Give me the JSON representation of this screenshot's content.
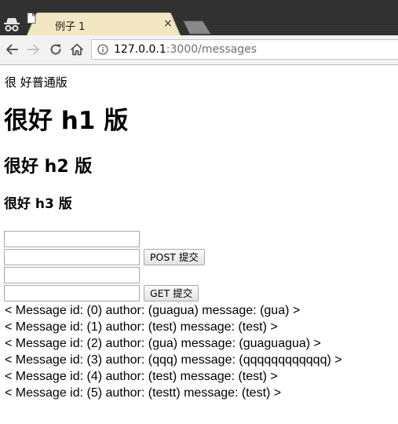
{
  "browser": {
    "tab_title": "例子 1",
    "tab_close": "×",
    "url_host": "127.0.0.1",
    "url_rest": ":3000/messages"
  },
  "page": {
    "plain_text": "很 好普通版",
    "h1": "很好 h1 版",
    "h2": "很好 h2 版",
    "h3": "很好 h3 版",
    "form": {
      "post_field_1_value": "",
      "post_field_2_value": "",
      "post_button_label": "POST 提交",
      "get_field_1_value": "",
      "get_field_2_value": "",
      "get_button_label": "GET 提交"
    },
    "messages": [
      "< Message id: (0) author: (guagua) message: (gua) >",
      "< Message id: (1) author: (test) message: (test) >",
      "< Message id: (2) author: (gua) message: (guaguagua) >",
      "< Message id: (3) author: (qqq) message: (qqqqqqqqqqqq) >",
      "< Message id: (4) author: (test) message: (test) >",
      "< Message id: (5) author: (testt) message: (test) >"
    ]
  },
  "icons": {
    "incognito": "incognito-icon",
    "page": "page-icon",
    "back": "back-arrow-icon",
    "forward": "forward-arrow-icon",
    "reload": "reload-icon",
    "home": "home-icon",
    "info": "info-icon"
  },
  "colors": {
    "tabstrip": "#2f2f2f",
    "active_tab": "#f2e6c3",
    "toolbar": "#f2f2f2",
    "url_rest": "#6f6f6f"
  }
}
